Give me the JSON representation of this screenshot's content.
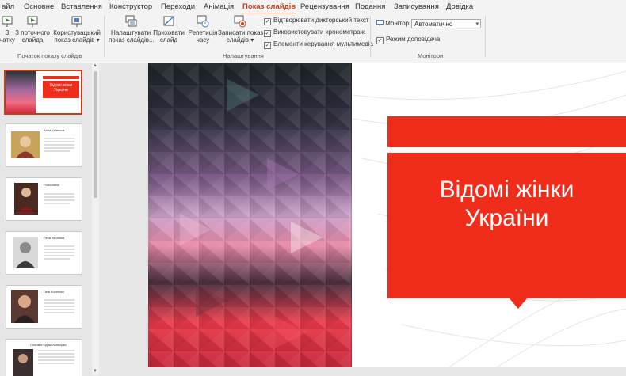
{
  "ribbon_tabs": [
    {
      "label": "айл"
    },
    {
      "label": "Основне"
    },
    {
      "label": "Вставлення"
    },
    {
      "label": "Конструктор"
    },
    {
      "label": "Переходи"
    },
    {
      "label": "Анімація"
    },
    {
      "label": "Показ слайдів",
      "active": true
    },
    {
      "label": "Рецензування"
    },
    {
      "label": "Подання"
    },
    {
      "label": "Записування"
    },
    {
      "label": "Довідка"
    }
  ],
  "groups": {
    "start": {
      "label": "Початок показу слайдів",
      "from_beginning_line1": "З",
      "from_beginning_line2": "чатку",
      "from_current_line1": "З поточного",
      "from_current_line2": "слайда",
      "custom_line1": "Користувацький",
      "custom_line2": "показ слайдів ▾"
    },
    "setup": {
      "label": "Налаштування",
      "setup_show_line1": "Налаштувати",
      "setup_show_line2": "показ слайдів...",
      "hide_line1": "Приховати",
      "hide_line2": "слайд",
      "rehearse_line1": "Репетиція",
      "rehearse_line2": "часу",
      "record_line1": "Записати показ",
      "record_line2": "слайдів ▾",
      "play_narrations": "Відтворювати дикторський текст",
      "use_timings": "Використовувати хронометраж",
      "show_media_controls": "Елементи керування мультимедіа"
    },
    "monitors": {
      "label": "Монітори",
      "monitor_label": "Монітор:",
      "monitor_value": "Автоматично",
      "presenter_view": "Режим доповідача"
    }
  },
  "thumbnails": [
    {
      "title": "Відомі жінки України"
    },
    {
      "title": "Анна Київська"
    },
    {
      "title": "Роксолана"
    },
    {
      "title": "Леся Українка"
    },
    {
      "title": "Ліна Костенко"
    },
    {
      "title": "Соломія Крушельницька"
    }
  ],
  "slide": {
    "title": "Відомі жінки\nУкраїни"
  },
  "colors": {
    "accent": "#c43e1c",
    "slide_red": "#f02c1a"
  }
}
